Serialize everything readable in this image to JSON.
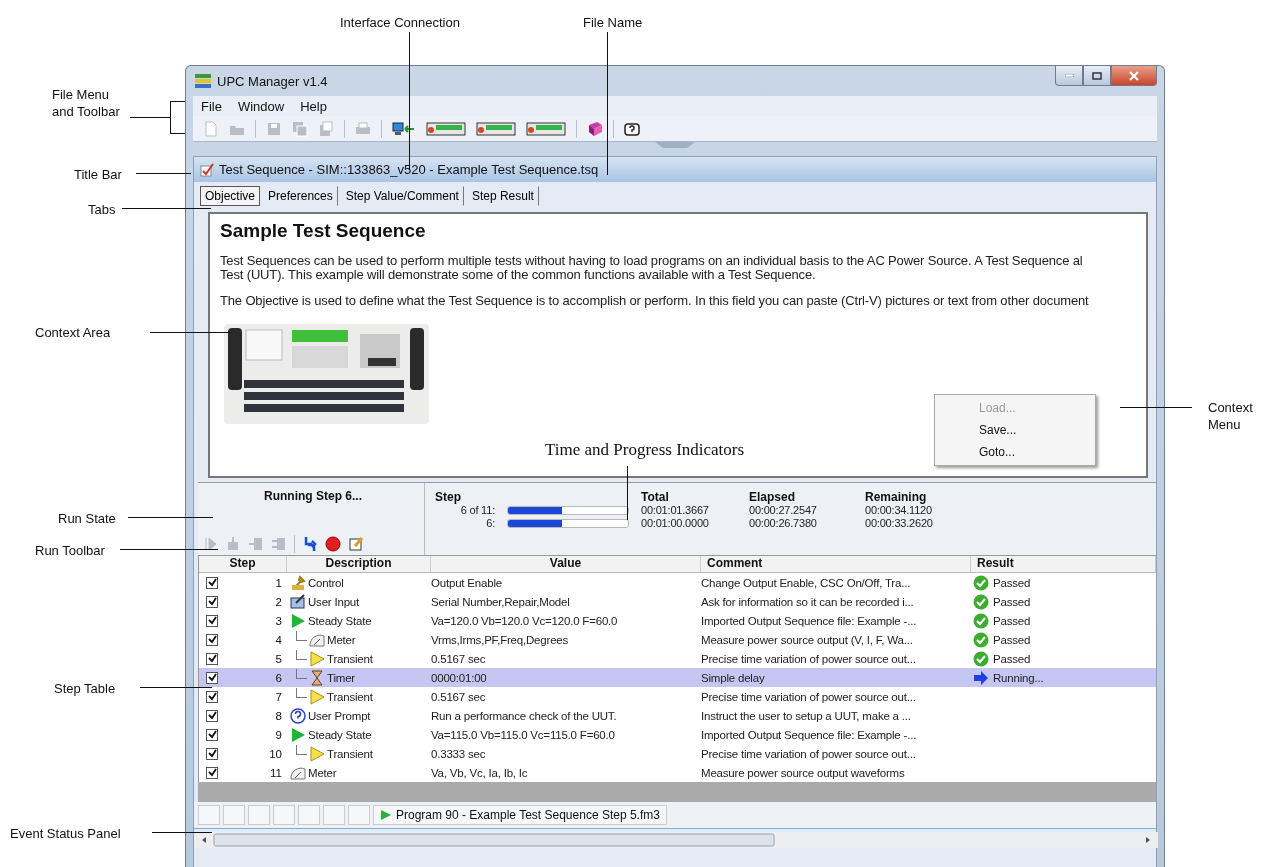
{
  "callouts": [
    {
      "text": "Interface Connection"
    },
    {
      "text": "File Name"
    },
    {
      "text": "File Menu\nand Toolbar"
    },
    {
      "text": "Title Bar"
    },
    {
      "text": "Tabs"
    },
    {
      "text": "Context Area"
    },
    {
      "text": "Context\nMenu"
    },
    {
      "text": "Time and Progress Indicators"
    },
    {
      "text": "Run State"
    },
    {
      "text": "Run Toolbar"
    },
    {
      "text": "Step Table"
    },
    {
      "text": "Event Status Panel"
    }
  ],
  "window": {
    "title": "UPC Manager v1.4"
  },
  "menu": [
    "File",
    "Window",
    "Help"
  ],
  "toolbar": [
    {
      "kind": "new",
      "disabled": true
    },
    {
      "kind": "open",
      "disabled": true
    },
    {
      "kind": "sep"
    },
    {
      "kind": "save",
      "disabled": true
    },
    {
      "kind": "save_all",
      "disabled": true
    },
    {
      "kind": "export",
      "disabled": true
    },
    {
      "kind": "sep"
    },
    {
      "kind": "print",
      "disabled": true
    },
    {
      "kind": "sep"
    },
    {
      "kind": "connect",
      "disabled": false
    },
    {
      "kind": "panel",
      "disabled": false
    },
    {
      "kind": "panel",
      "disabled": false
    },
    {
      "kind": "panel",
      "disabled": false
    },
    {
      "kind": "sep"
    },
    {
      "kind": "book",
      "disabled": false
    },
    {
      "kind": "sep"
    },
    {
      "kind": "help",
      "disabled": false
    }
  ],
  "document": {
    "title": "Test Sequence - SIM::133863_v520 - Example Test Sequence.tsq"
  },
  "tabs": [
    {
      "label": "Objective",
      "selected": true
    },
    {
      "label": "Preferences",
      "selected": false
    },
    {
      "label": "Step Value/Comment",
      "selected": false
    },
    {
      "label": "Step Result",
      "selected": false
    }
  ],
  "objective": {
    "heading": "Sample Test Sequence",
    "paragraphs": [
      [
        "Test Sequences can be used to perform multiple tests without having to load programs on an individual basis to the AC Power Source. A Test Sequence al",
        "Test (UUT). This example will demonstrate some of the common functions available with a Test Sequence."
      ],
      [
        "The Objective is used to define what the Test Sequence is to accomplish or perform. In this field you can paste (Ctrl-V) pictures or text from other document"
      ]
    ],
    "image": {
      "kind": "picture"
    }
  },
  "context_menu": [
    {
      "label": "Load...",
      "disabled": true
    },
    {
      "label": "Save...",
      "disabled": false
    },
    {
      "label": "Goto...",
      "disabled": false
    }
  ],
  "run_state": "Running Step 6...",
  "run_toolbar": [
    {
      "kind": "play",
      "disabled": true
    },
    {
      "kind": "step",
      "disabled": true
    },
    {
      "kind": "step_in",
      "disabled": true
    },
    {
      "kind": "step_out",
      "disabled": true
    },
    {
      "kind": "sep"
    },
    {
      "kind": "refresh",
      "disabled": false
    },
    {
      "kind": "stop",
      "disabled": false
    },
    {
      "kind": "edit",
      "disabled": false
    }
  ],
  "progress": {
    "headers": [
      "Step",
      "Total",
      "Elapsed",
      "Remaining"
    ],
    "rows": [
      {
        "label": "6 of 11:",
        "level": 0.45,
        "total": "00:01:01.3667",
        "elapsed": "00:00:27.2547",
        "remaining": "00:00:34.1120"
      },
      {
        "label": "6:",
        "level": 0.45,
        "total": "00:01:00.0000",
        "elapsed": "00:00:26.7380",
        "remaining": "00:00:33.2620"
      }
    ]
  },
  "table": {
    "columns": [
      "Step",
      "Description",
      "Value",
      "Comment",
      "Result"
    ],
    "steps": [
      {
        "step": "1",
        "kind": "control",
        "description": "Control",
        "value": "Output Enable",
        "comment": "Change Output Enable, CSC On/Off, Tra...",
        "result": {
          "kind": "passed",
          "text": "Passed"
        },
        "checked": true,
        "selected": false
      },
      {
        "step": "2",
        "kind": "user_input",
        "description": "User Input",
        "value": "Serial Number,Repair,Model",
        "comment": "Ask for information so it can be recorded i...",
        "result": {
          "kind": "passed",
          "text": "Passed"
        },
        "checked": true,
        "selected": false
      },
      {
        "step": "3",
        "kind": "steady_state",
        "description": "Steady State",
        "value": "Va=120.0 Vb=120.0 Vc=120.0 F=60.0",
        "comment": "Imported Output Sequence file: Example -...",
        "result": {
          "kind": "passed",
          "text": "Passed"
        },
        "checked": true,
        "selected": false,
        "children": [
          {
            "step": "4",
            "kind": "meter",
            "description": "Meter",
            "value": "Vrms,Irms,PF,Freq,Degrees",
            "comment": "Measure power source output (V, I, F, Wa...",
            "result": {
              "kind": "passed",
              "text": "Passed"
            },
            "checked": true,
            "selected": false
          },
          {
            "step": "5",
            "kind": "transient",
            "description": "Transient",
            "value": "0.5167 sec",
            "comment": "Precise time variation of power source out...",
            "result": {
              "kind": "passed",
              "text": "Passed"
            },
            "checked": true,
            "selected": false
          },
          {
            "step": "6",
            "kind": "timer",
            "description": "Timer",
            "value": "0000:01:00",
            "comment": "Simple delay",
            "result": {
              "kind": "running",
              "text": "Running..."
            },
            "checked": true,
            "selected": true
          },
          {
            "step": "7",
            "kind": "transient",
            "description": "Transient",
            "value": "0.5167 sec",
            "comment": "Precise time variation of power source out...",
            "checked": true,
            "selected": false
          }
        ]
      },
      {
        "step": "8",
        "kind": "user_prompt",
        "description": "User Prompt",
        "value": "Run a performance check of the UUT.",
        "comment": "Instruct the user to setup a UUT, make a ...",
        "checked": true,
        "selected": false
      },
      {
        "step": "9",
        "kind": "steady_state",
        "description": "Steady State",
        "value": "Va=115.0 Vb=115.0 Vc=115.0 F=60.0",
        "comment": "Imported Output Sequence file: Example -...",
        "checked": true,
        "selected": false,
        "children": [
          {
            "step": "10",
            "kind": "transient",
            "description": "Transient",
            "value": "0.3333 sec",
            "comment": "Precise time variation of power source out...",
            "checked": true,
            "selected": false
          }
        ]
      },
      {
        "step": "11",
        "kind": "meter",
        "description": "Meter",
        "value": "Va, Vb, Vc, Ia, Ib, Ic",
        "comment": "Measure power source output waveforms",
        "checked": true,
        "selected": false
      }
    ]
  },
  "status_panel": {
    "message": "Program 90 - Example Test Sequence Step 5.fm3"
  }
}
